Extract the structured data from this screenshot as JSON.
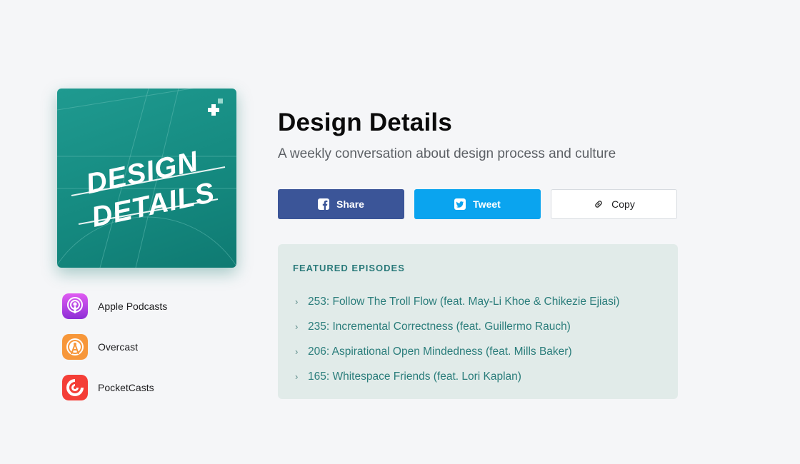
{
  "podcast": {
    "title": "Design Details",
    "subtitle": "A weekly conversation about design process and culture",
    "cover_text_line1": "DESIGN",
    "cover_text_line2": "DETAILS"
  },
  "share": {
    "share_label": "Share",
    "tweet_label": "Tweet",
    "copy_label": "Copy"
  },
  "apps": [
    {
      "label": "Apple Podcasts",
      "icon": "apple-podcasts-icon"
    },
    {
      "label": "Overcast",
      "icon": "overcast-icon"
    },
    {
      "label": "PocketCasts",
      "icon": "pocketcasts-icon"
    }
  ],
  "featured": {
    "heading": "FEATURED EPISODES",
    "episodes": [
      "253: Follow The Troll Flow (feat. May-Li Khoe & Chikezie Ejiasi)",
      "235: Incremental Correctness (feat. Guillermo Rauch)",
      "206: Aspirational Open Mindedness (feat. Mills Baker)",
      "165: Whitespace Friends (feat. Lori Kaplan)"
    ]
  },
  "colors": {
    "facebook": "#3b5598",
    "twitter": "#0aa4ef",
    "teal": "#2a7d7b",
    "featured_bg": "#e1ebe9"
  }
}
